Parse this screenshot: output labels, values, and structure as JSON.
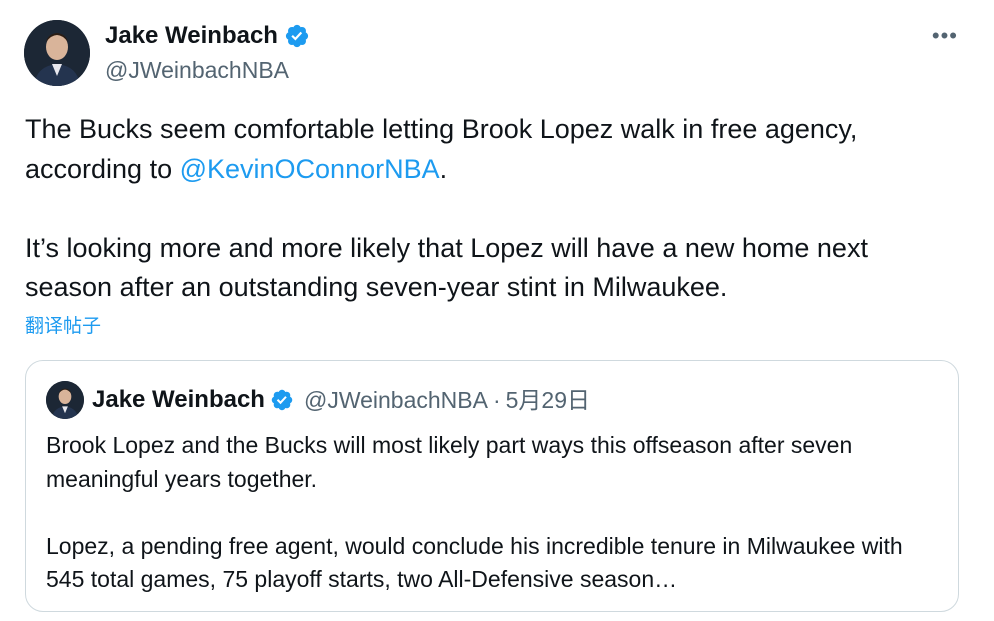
{
  "author": {
    "display_name": "Jake Weinbach",
    "handle": "@JWeinbachNBA",
    "verified": true,
    "avatar_icon": "profile-photo"
  },
  "tweet": {
    "line1_prefix": "The Bucks seem comfortable letting Brook Lopez walk in free agency, according to ",
    "mention": "@KevinOConnorNBA",
    "line1_suffix": ".",
    "paragraph2": "It’s looking more and more likely that Lopez will have a new home next season after an outstanding seven-year stint in Milwaukee."
  },
  "translate_label": "翻译帖子",
  "more_icon": "more-horizontal-icon",
  "quote": {
    "display_name": "Jake Weinbach",
    "handle": "@JWeinbachNBA",
    "separator": "·",
    "date": "5月29日",
    "paragraph1": "Brook Lopez and the Bucks will most likely part ways this offseason after seven meaningful years together.",
    "paragraph2": "Lopez, a pending free agent, would conclude his incredible tenure in Milwaukee with 545 total games, 75 playoff starts, two All-Defensive season…"
  },
  "colors": {
    "link": "#1d9bf0",
    "text": "#0f1419",
    "secondary": "#536471",
    "border": "#cfd9de",
    "verified": "#1d9bf0"
  }
}
